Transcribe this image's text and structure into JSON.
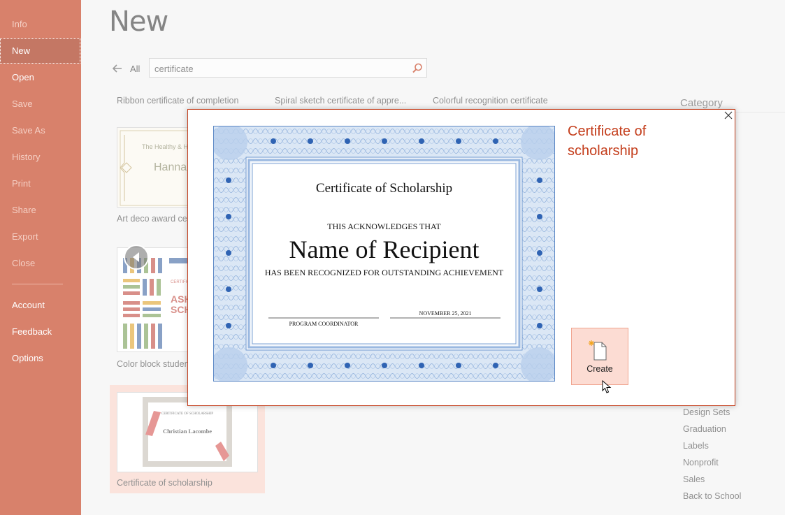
{
  "sidebar": {
    "items": [
      {
        "label": "Info"
      },
      {
        "label": "New"
      },
      {
        "label": "Open"
      },
      {
        "label": "Save"
      },
      {
        "label": "Save As"
      },
      {
        "label": "History"
      },
      {
        "label": "Print"
      },
      {
        "label": "Share"
      },
      {
        "label": "Export"
      },
      {
        "label": "Close"
      },
      {
        "label": "Account"
      },
      {
        "label": "Feedback"
      },
      {
        "label": "Options"
      }
    ],
    "accent": "#c43e1c"
  },
  "main": {
    "title": "New",
    "back_label": "All",
    "search": {
      "value": "certificate"
    },
    "top_templates": [
      "Ribbon certificate of completion",
      "Spiral sketch certificate of appre...",
      "Colorful recognition certificate"
    ],
    "templates": [
      {
        "label": "Art deco award cert",
        "thumb_text": "The Healthy & H",
        "thumb_name": "Hanna"
      },
      {
        "label": "Color block student",
        "thumb_text": "CERTIFICAT",
        "thumb_name": "ASH SCH"
      },
      {
        "label": "Certificate of scholarship",
        "thumb_text": "CERTIFICATE OF SCHOLARSHIP",
        "thumb_name": "Christian Lacombe"
      }
    ],
    "category": {
      "label": "Category",
      "items": [
        "Design Sets",
        "Graduation",
        "Labels",
        "Nonprofit",
        "Sales",
        "Back to School"
      ]
    }
  },
  "dialog": {
    "title": "Certificate of scholarship",
    "create_label": "Create",
    "certificate": {
      "heading": "Certificate of Scholarship",
      "acknowledges": "THIS ACKNOWLEDGES THAT",
      "recipient": "Name of Recipient",
      "recognized": "HAS BEEN RECOGNIZED FOR OUTSTANDING ACHIEVEMENT",
      "signer": "PROGRAM COORDINATOR",
      "date": "NOVEMBER 25, 2021"
    }
  },
  "icons": {
    "back": "arrow-left-icon",
    "search": "search-icon",
    "close": "close-icon",
    "prev": "chevron-left-icon",
    "create": "new-document-icon"
  }
}
